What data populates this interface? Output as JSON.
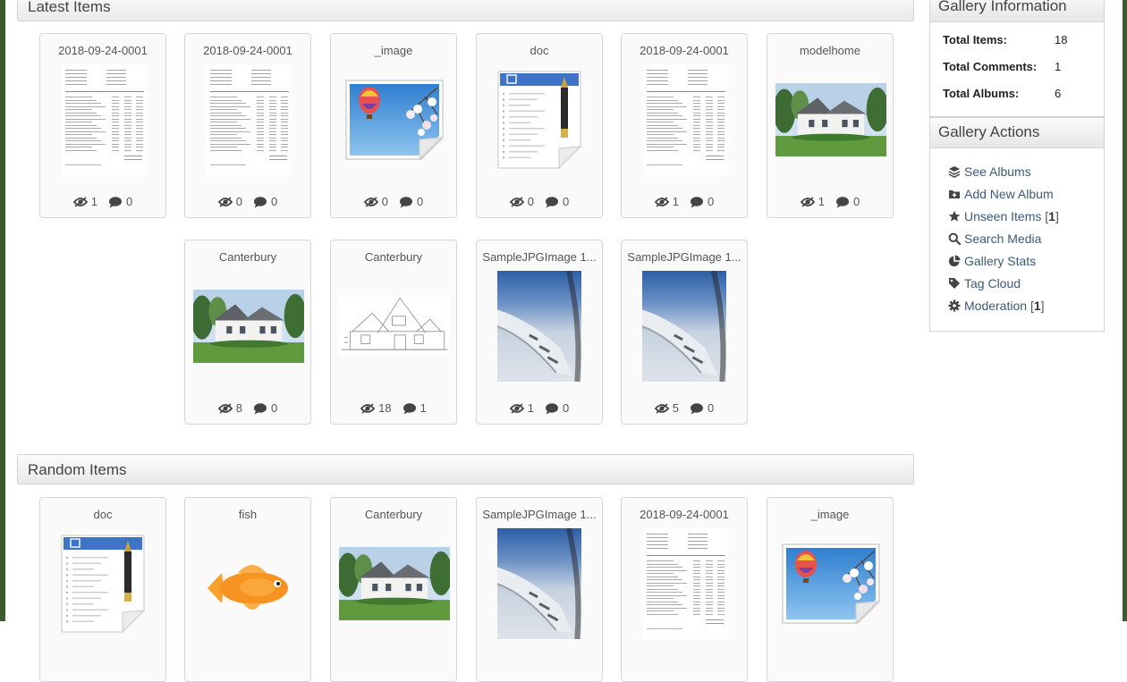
{
  "latest": {
    "title": "Latest Items",
    "items": [
      {
        "title": "2018-09-24-0001",
        "views": "1",
        "comments": "0",
        "thumb": "document-thumbnail"
      },
      {
        "title": "2018-09-24-0001",
        "views": "0",
        "comments": "0",
        "thumb": "document-thumbnail"
      },
      {
        "title": "_image",
        "views": "0",
        "comments": "0",
        "thumb": "image-file-icon"
      },
      {
        "title": "doc",
        "views": "0",
        "comments": "0",
        "thumb": "text-document-icon"
      },
      {
        "title": "2018-09-24-0001",
        "views": "1",
        "comments": "0",
        "thumb": "document-thumbnail"
      },
      {
        "title": "modelhome",
        "views": "1",
        "comments": "0",
        "thumb": "house-photo"
      },
      {
        "title": "Canterbury",
        "views": "8",
        "comments": "0",
        "thumb": "house-photo"
      },
      {
        "title": "Canterbury",
        "views": "18",
        "comments": "1",
        "thumb": "house-sketch"
      },
      {
        "title": "SampleJPGImage 1...",
        "views": "1",
        "comments": "0",
        "thumb": "airplane-wing-photo"
      },
      {
        "title": "SampleJPGImage 1...",
        "views": "5",
        "comments": "0",
        "thumb": "airplane-wing-photo"
      }
    ]
  },
  "random": {
    "title": "Random Items",
    "items": [
      {
        "title": "doc",
        "thumb": "text-document-icon"
      },
      {
        "title": "fish",
        "thumb": "goldfish-image"
      },
      {
        "title": "Canterbury",
        "thumb": "house-photo"
      },
      {
        "title": "SampleJPGImage 1...",
        "thumb": "airplane-wing-photo"
      },
      {
        "title": "2018-09-24-0001",
        "thumb": "document-thumbnail"
      },
      {
        "title": "_image",
        "thumb": "image-file-icon"
      }
    ]
  },
  "gallery_info": {
    "title": "Gallery Information",
    "rows": [
      {
        "label": "Total Items:",
        "value": "18"
      },
      {
        "label": "Total Comments:",
        "value": "1"
      },
      {
        "label": "Total Albums:",
        "value": "6"
      }
    ]
  },
  "gallery_actions": {
    "title": "Gallery Actions",
    "items": [
      {
        "label": "See Albums",
        "icon": "layers-icon"
      },
      {
        "label": "Add New Album",
        "icon": "folder-plus-icon"
      },
      {
        "label": "Unseen Items",
        "count": "1",
        "icon": "star-icon"
      },
      {
        "label": "Search Media",
        "icon": "search-icon"
      },
      {
        "label": "Gallery Stats",
        "icon": "pie-chart-icon"
      },
      {
        "label": "Tag Cloud",
        "icon": "tag-icon"
      },
      {
        "label": "Moderation",
        "count": "1",
        "icon": "gear-icon"
      }
    ]
  },
  "colors": {
    "link": "#3a5a78",
    "border": "#d6d6d6",
    "frame": "#3d5a2e"
  },
  "stat_icons": {
    "views": "eye-icon",
    "comments": "comment-icon"
  }
}
